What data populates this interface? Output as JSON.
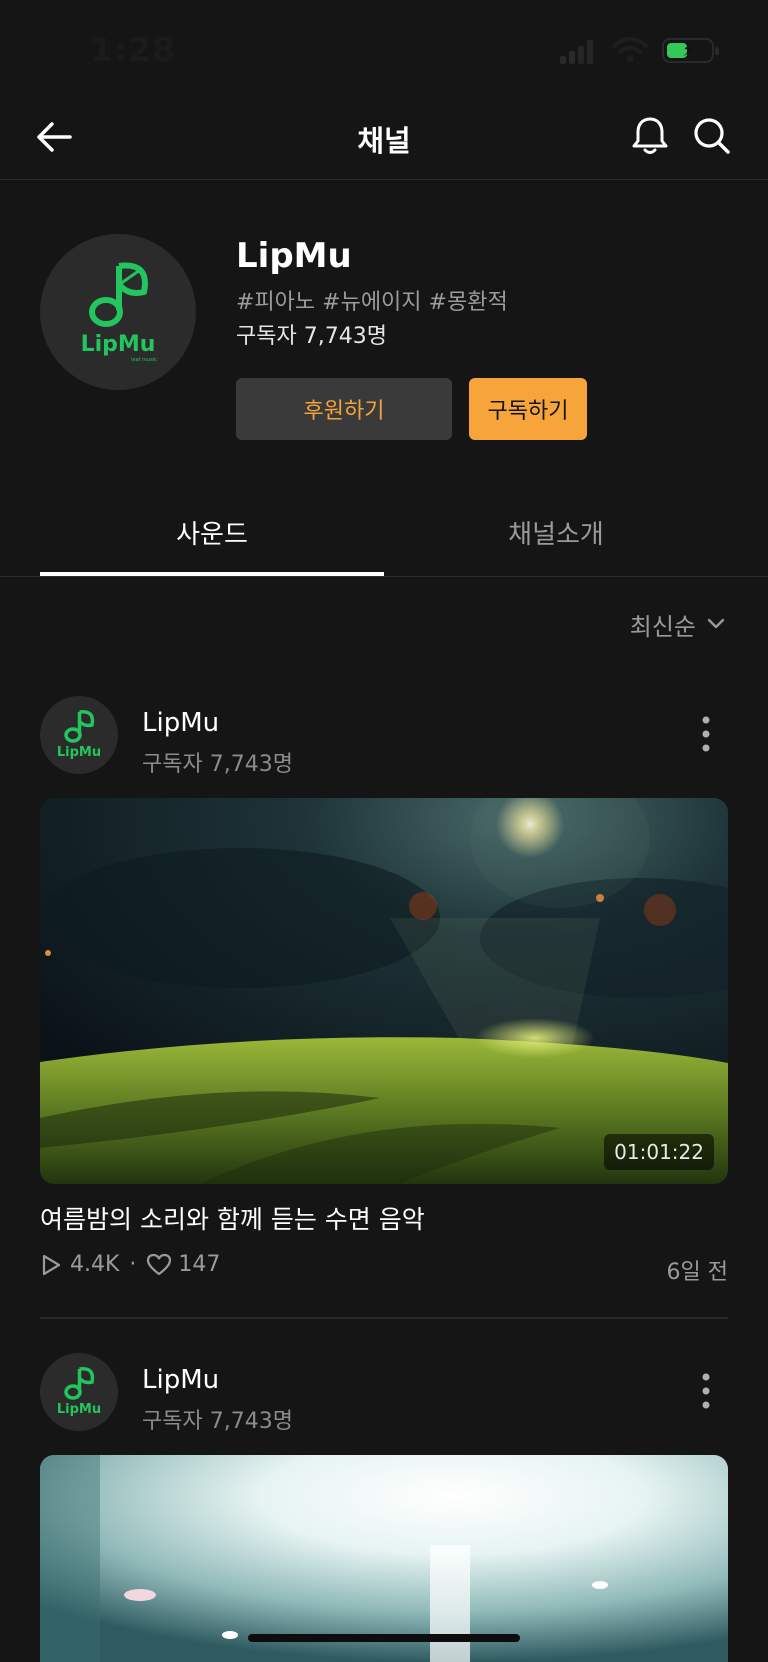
{
  "status_bar": {
    "time": "1:28"
  },
  "nav": {
    "title": "채널",
    "back_icon": "arrow-left-icon",
    "bell_icon": "bell-icon",
    "search_icon": "search-icon"
  },
  "channel": {
    "name": "LipMu",
    "tags": "#피아노 #뉴에이지 #몽환적",
    "subscribers": "구독자 7,743명",
    "sponsor_label": "후원하기",
    "subscribe_label": "구독하기",
    "logo_text": "LipMu",
    "logo_subtext": "leaf music",
    "brand_color": "#22c55e"
  },
  "tabs": [
    {
      "label": "사운드",
      "active": true
    },
    {
      "label": "채널소개",
      "active": false
    }
  ],
  "sort": {
    "label": "최신순"
  },
  "posts": [
    {
      "author": "LipMu",
      "subscribers": "구독자 7,743명",
      "duration": "01:01:22",
      "title": "여름밤의 소리와 함께 듣는 수면 음악",
      "plays": "4.4K",
      "likes": "147",
      "time_ago": "6일 전"
    },
    {
      "author": "LipMu",
      "subscribers": "구독자 7,743명"
    }
  ],
  "colors": {
    "accent": "#f7a53a",
    "background": "#151515"
  }
}
